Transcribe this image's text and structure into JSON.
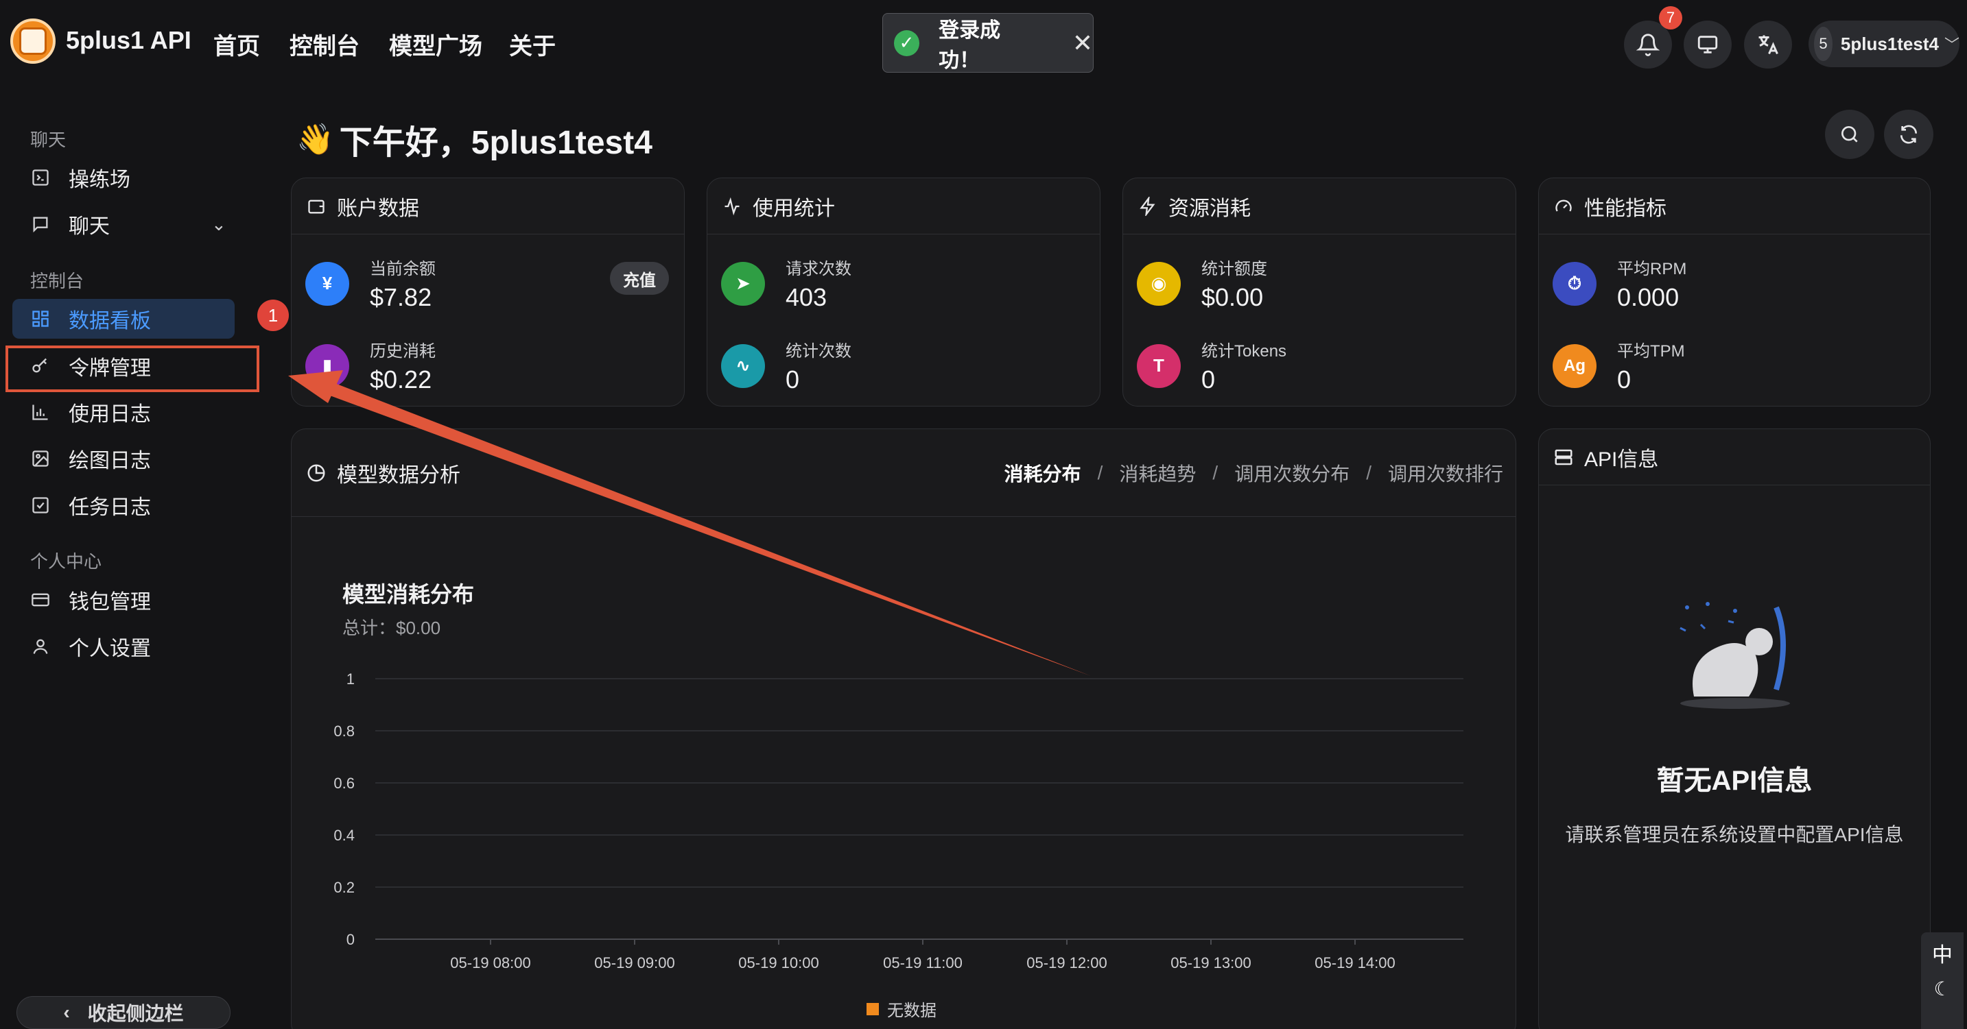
{
  "app": {
    "brand": "5plus1 API"
  },
  "nav": {
    "items": [
      "首页",
      "控制台",
      "模型广场",
      "关于"
    ]
  },
  "toast": {
    "message": "登录成功！"
  },
  "header": {
    "notification_count": "7",
    "user_initial": "5",
    "user_name": "5plus1test4"
  },
  "sidebar": {
    "groups": {
      "chat": "聊天",
      "console": "控制台",
      "personal": "个人中心"
    },
    "items": {
      "playground": "操练场",
      "chat": "聊天",
      "dashboard": "数据看板",
      "tokens": "令牌管理",
      "usage_log": "使用日志",
      "drawing_log": "绘图日志",
      "task_log": "任务日志",
      "wallet": "钱包管理",
      "settings": "个人设置"
    },
    "collapse_label": "收起侧边栏",
    "step_badge": "1"
  },
  "greeting": "下午好，5plus1test4",
  "cards": {
    "account": {
      "title": "账户数据",
      "balance_label": "当前余额",
      "balance_value": "$7.82",
      "recharge": "充值",
      "spent_label": "历史消耗",
      "spent_value": "$0.22"
    },
    "usage": {
      "title": "使用统计",
      "requests_label": "请求次数",
      "requests_value": "403",
      "count_label": "统计次数",
      "count_value": "0"
    },
    "resource": {
      "title": "资源消耗",
      "quota_label": "统计额度",
      "quota_value": "$0.00",
      "tokens_label": "统计Tokens",
      "tokens_value": "0"
    },
    "performance": {
      "title": "性能指标",
      "rpm_label": "平均RPM",
      "rpm_value": "0.000",
      "tpm_label": "平均TPM",
      "tpm_value": "0",
      "tpm_icon_text": "Ag"
    }
  },
  "analysis": {
    "title": "模型数据分析",
    "tabs": [
      "消耗分布",
      "消耗趋势",
      "调用次数分布",
      "调用次数排行"
    ],
    "active_tab": 0,
    "chart_title": "模型消耗分布",
    "chart_subtitle": "总计：$0.00"
  },
  "chart_data": {
    "type": "bar",
    "title": "模型消耗分布",
    "subtitle": "总计：$0.00",
    "categories": [
      "05-19 08:00",
      "05-19 09:00",
      "05-19 10:00",
      "05-19 11:00",
      "05-19 12:00",
      "05-19 13:00",
      "05-19 14:00"
    ],
    "y_ticks": [
      "1",
      "0.8",
      "0.6",
      "0.4",
      "0.2",
      "0"
    ],
    "ylim": [
      0,
      1
    ],
    "series": [
      {
        "name": "无数据",
        "values": [
          0,
          0,
          0,
          0,
          0,
          0,
          0
        ]
      }
    ],
    "legend": "bottom",
    "grid": true
  },
  "api_info": {
    "title": "API信息",
    "empty_title": "暂无API信息",
    "empty_desc": "请联系管理员在系统设置中配置API信息"
  },
  "side_tool": {
    "lang": "中"
  },
  "colors": {
    "accent": "#4b9bff",
    "highlight": "#e0563a",
    "balance": "#2d7ff9",
    "spent": "#8a2bb8",
    "requests": "#2f9e44",
    "count": "#1a9aa8",
    "quota": "#e5b800",
    "tokens": "#d42f6a",
    "rpm": "#3b4cc0",
    "tpm": "#f08a1e"
  }
}
